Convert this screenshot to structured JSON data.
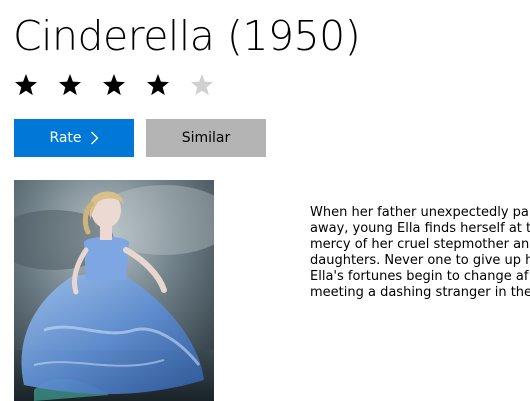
{
  "movie": {
    "title": "Cinderella (1950)",
    "rating": {
      "value": 4,
      "max": 5
    },
    "poster_alt": "Cinderella poster"
  },
  "actions": {
    "rate_label": "Rate",
    "similar_label": "Similar"
  },
  "description": {
    "lines": [
      "When her father unexpectedly pa",
      "away, young Ella finds herself at th",
      "mercy of her cruel stepmother an",
      "daughters. Never one to give up h",
      "Ella's fortunes begin to change af",
      "meeting a dashing stranger in the"
    ]
  },
  "colors": {
    "accent": "#0078d7",
    "secondary_button": "#b4b4b4",
    "star_filled": "#000000",
    "star_empty": "#d0d0d0"
  },
  "icons": {
    "rate_chevron": "chevron-right-icon",
    "star": "star-icon"
  }
}
